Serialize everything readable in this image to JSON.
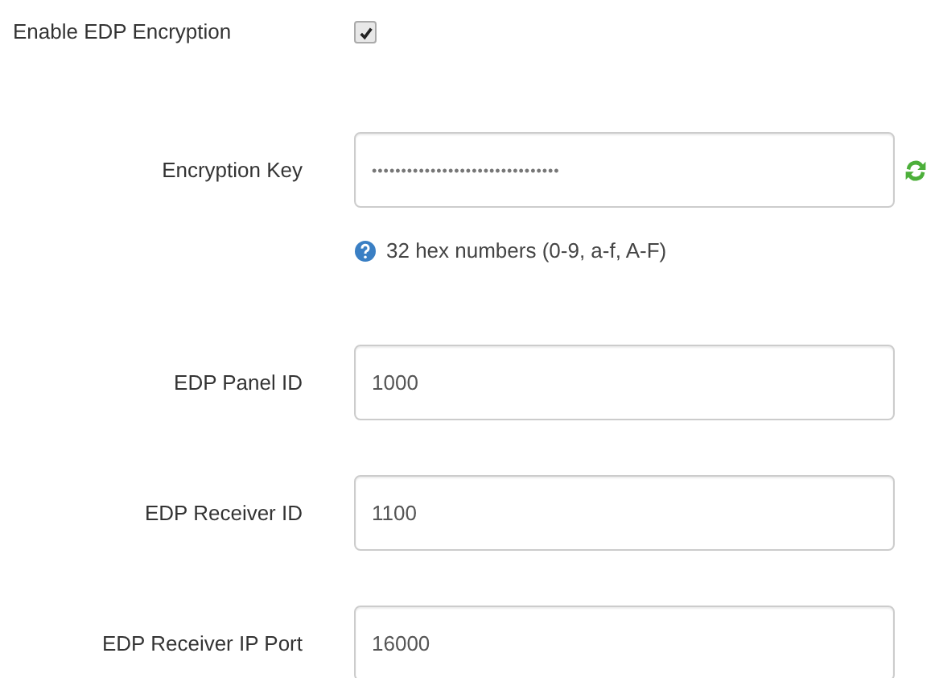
{
  "fields": [
    {
      "kind": "checkbox",
      "label": "Enable EDP Encryption",
      "checked": true
    },
    {
      "kind": "password",
      "label": "Encryption Key",
      "value": "••••••••••••••••••••••••••••••••",
      "hint": "32 hex numbers (0-9, a-f, A-F)"
    },
    {
      "kind": "text",
      "label": "EDP Panel ID",
      "value": "1000"
    },
    {
      "kind": "text",
      "label": "EDP Receiver ID",
      "value": "1100"
    },
    {
      "kind": "text",
      "label": "EDP Receiver IP Port",
      "value": "16000"
    }
  ]
}
